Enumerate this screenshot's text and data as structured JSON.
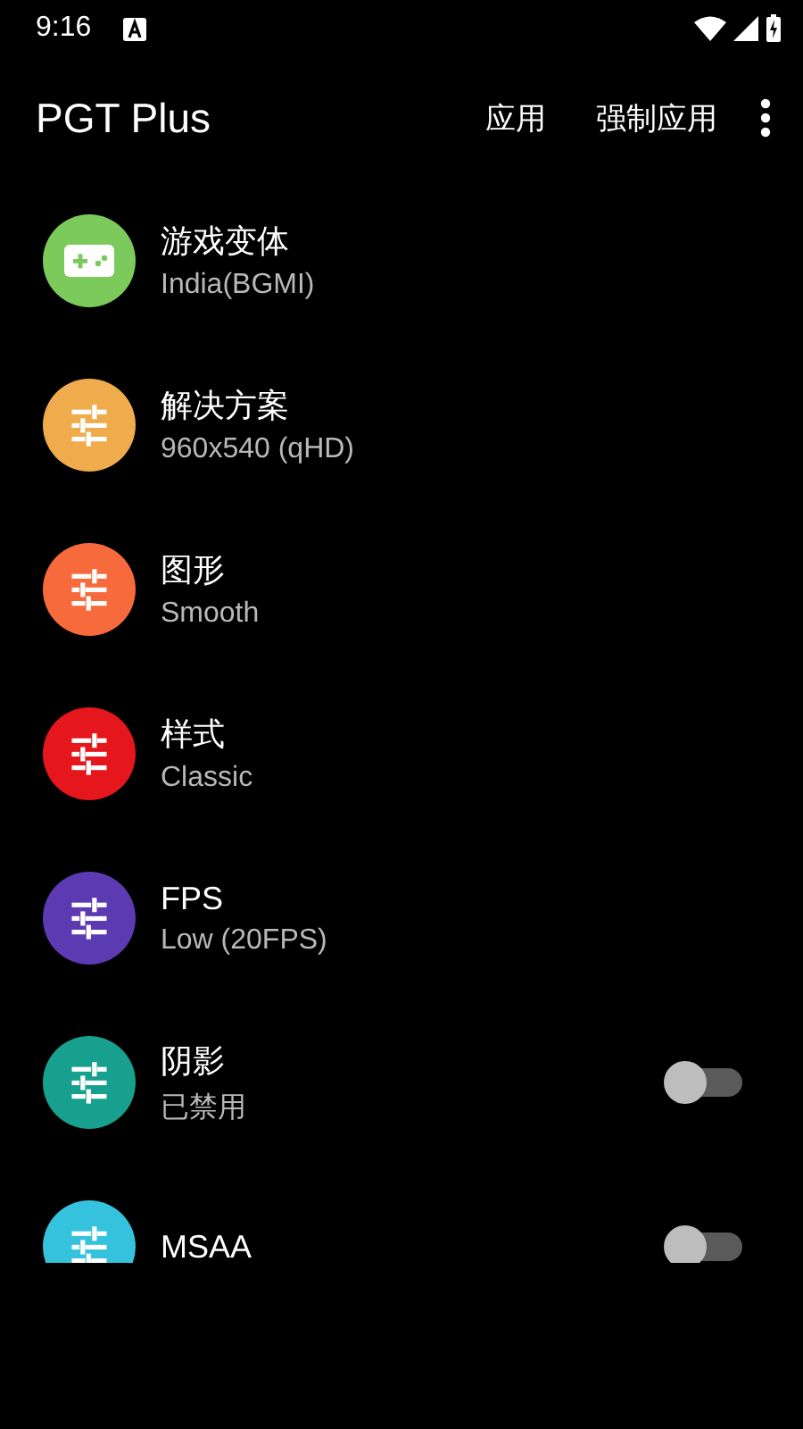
{
  "status_bar": {
    "time": "9:16"
  },
  "app_bar": {
    "title": "PGT Plus",
    "actions": [
      "应用",
      "强制应用"
    ]
  },
  "items": [
    {
      "kind": "game-select",
      "title": "游戏变体",
      "value": "India(BGMI)",
      "color": "#7cc95c"
    },
    {
      "kind": "select",
      "title": "解决方案",
      "value": "960x540 (qHD)",
      "color": "#efab4c"
    },
    {
      "kind": "select",
      "title": "图形",
      "value": "Smooth",
      "color": "#f76a3c"
    },
    {
      "kind": "select",
      "title": "样式",
      "value": "Classic",
      "color": "#e5161c"
    },
    {
      "kind": "select",
      "title": "FPS",
      "value": "Low (20FPS)",
      "color": "#5b3ab2"
    },
    {
      "kind": "toggle",
      "title": "阴影",
      "value": "已禁用",
      "on": false,
      "color": "#17a08e"
    },
    {
      "kind": "toggle",
      "title": "MSAA",
      "on": false,
      "color": "#35c2dc"
    }
  ]
}
